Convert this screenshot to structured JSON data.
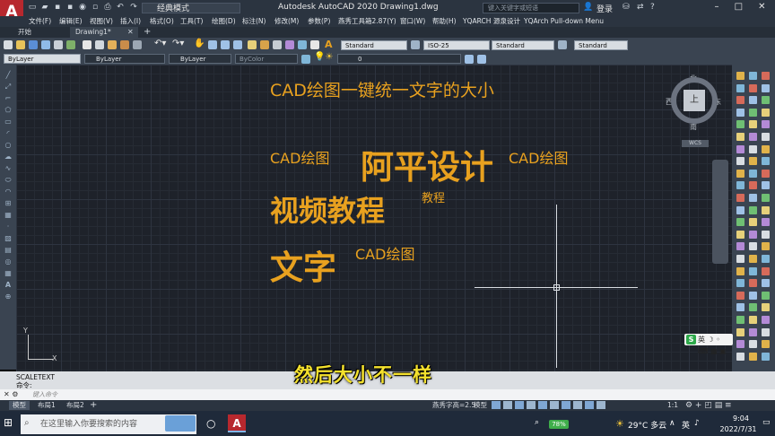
{
  "window": {
    "app_title": "Autodesk AutoCAD 2020   Drawing1.dwg",
    "workspace": "经典模式",
    "search_placeholder": "键入关键字或短语",
    "login": "登录",
    "logo": "A"
  },
  "menu": [
    "文件(F)",
    "编辑(E)",
    "视图(V)",
    "插入(I)",
    "格式(O)",
    "工具(T)",
    "绘图(D)",
    "标注(N)",
    "修改(M)",
    "参数(P)",
    "燕秀工具箱2.87(Y)",
    "窗口(W)",
    "帮助(H)",
    "YQARCH",
    "源泉设计",
    "YQArch Pull-down Menu"
  ],
  "doc_tabs": {
    "start": "开始",
    "drawing": "Drawing1*"
  },
  "toolbar": {
    "text_style": "Standard",
    "dim_style": "ISO-25",
    "table_style": "Standard",
    "mleader_style": "Standard",
    "layer_combo": "ByLayer",
    "linetype": "ByLayer",
    "lineweight": "ByLayer",
    "plot_color": "ByColor",
    "layer_name": "0"
  },
  "canvas_text": [
    {
      "text": "CAD绘图一键统一文字的大小",
      "size": 19
    },
    {
      "text": "CAD绘图",
      "size": 16
    },
    {
      "text": "阿平设计",
      "size": 37
    },
    {
      "text": "CAD绘图",
      "size": 16
    },
    {
      "text": "视频教程",
      "size": 32
    },
    {
      "text": "教程",
      "size": 13
    },
    {
      "text": "文字",
      "size": 37
    },
    {
      "text": "CAD绘图",
      "size": 16
    }
  ],
  "viewcube": {
    "north": "北",
    "south": "南",
    "east": "东",
    "west": "西",
    "face": "上",
    "wcs": "WCS"
  },
  "ucs": {
    "x": "X",
    "y": "Y"
  },
  "ime": {
    "logo": "S",
    "label": "英"
  },
  "command": {
    "history": "SCALETEXT",
    "prompt_line": "命令:",
    "input_placeholder": "键入命令"
  },
  "subtitle": "然后大小不一样",
  "status": {
    "tabs": [
      "模型",
      "布局1",
      "布局2"
    ],
    "text_height": "燕秀字高=2.5",
    "model": "模型",
    "scale": "1:1"
  },
  "taskbar": {
    "search": "在这里输入你要搜索的内容",
    "battery": "78%",
    "weather": "29°C  多云",
    "lang": "英",
    "time": "9:04",
    "date": "2022/7/31"
  }
}
